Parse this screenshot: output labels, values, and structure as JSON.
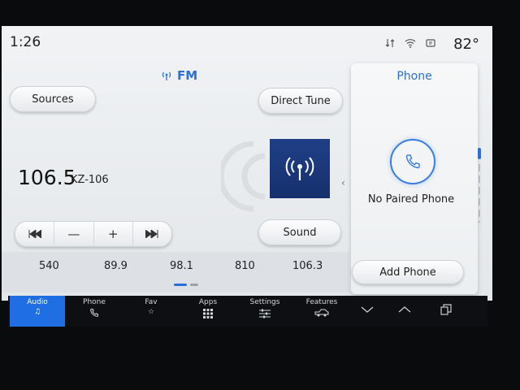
{
  "status": {
    "time": "1:26",
    "temperature": "82°"
  },
  "band": {
    "label": "FM"
  },
  "buttons": {
    "sources": "Sources",
    "direct_tune": "Direct Tune",
    "sound": "Sound"
  },
  "now_playing": {
    "frequency": "106.5",
    "callsign": "KZ-106"
  },
  "presets": [
    "540",
    "89.9",
    "98.1",
    "810",
    "106.3"
  ],
  "phone": {
    "title": "Phone",
    "status": "No Paired Phone",
    "add_button": "Add Phone"
  },
  "nav": {
    "items": [
      {
        "label": "Audio",
        "icon": "music-note-icon",
        "active": true
      },
      {
        "label": "Phone",
        "icon": "phone-icon",
        "active": false
      },
      {
        "label": "Fav",
        "icon": "star-icon",
        "active": false
      },
      {
        "label": "Apps",
        "icon": "grid-icon",
        "active": false
      },
      {
        "label": "Settings",
        "icon": "sliders-icon",
        "active": false
      },
      {
        "label": "Features",
        "icon": "truck-icon",
        "active": false
      }
    ]
  },
  "colors": {
    "accent": "#2b6fd6",
    "active_nav": "#1f6ee3",
    "album_art": "#1f3f86"
  }
}
